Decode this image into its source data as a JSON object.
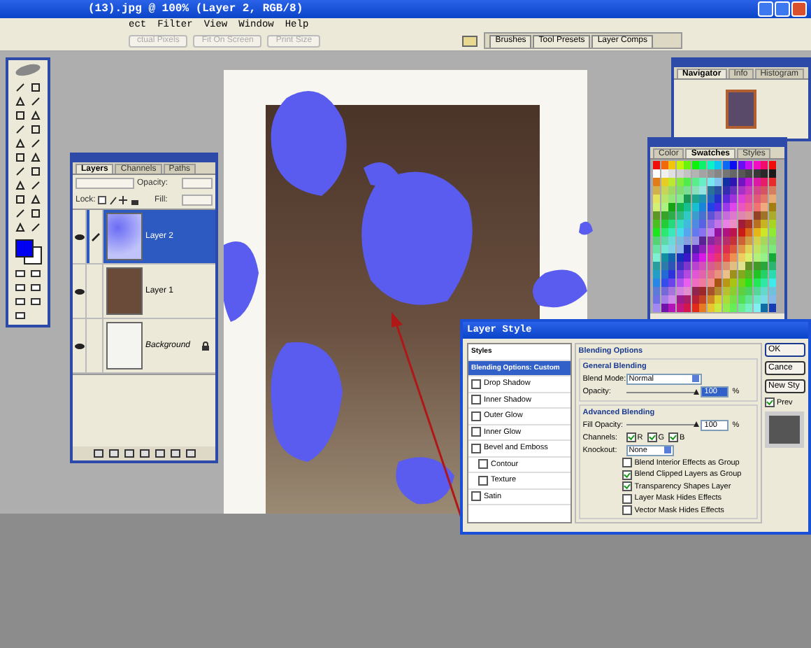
{
  "window": {
    "title": "(13).jpg @ 100% (Layer 2, RGB/8)"
  },
  "menu": [
    "ect",
    "Filter",
    "View",
    "Window",
    "Help"
  ],
  "options_bar": {
    "buttons": [
      {
        "label": "ctual Pixels",
        "disabled": true
      },
      {
        "label": "Fit On Screen",
        "disabled": true
      },
      {
        "label": "Print Size",
        "disabled": true
      }
    ]
  },
  "palette_well": {
    "tabs": [
      "Brushes",
      "Tool Presets",
      "Layer Comps"
    ]
  },
  "navigator": {
    "tabs": [
      {
        "label": "Navigator",
        "selected": true
      },
      {
        "label": "Info",
        "selected": false
      },
      {
        "label": "Histogram",
        "selected": false
      }
    ]
  },
  "swatches": {
    "tabs": [
      {
        "label": "Color",
        "selected": false
      },
      {
        "label": "Swatches",
        "selected": true
      },
      {
        "label": "Styles",
        "selected": false
      }
    ]
  },
  "layers": {
    "tabs": [
      {
        "label": "Layers",
        "selected": true
      },
      {
        "label": "Channels",
        "selected": false
      },
      {
        "label": "Paths",
        "selected": false
      }
    ],
    "opacity_label": "Opacity:",
    "lock_label": "Lock:",
    "fill_label": "Fill:",
    "items": [
      {
        "name": "Layer 2",
        "kind": "paint",
        "selected": true,
        "visible": true,
        "locked": false
      },
      {
        "name": "Layer 1",
        "kind": "photo",
        "selected": false,
        "visible": true,
        "locked": false
      },
      {
        "name": "Background",
        "kind": "blank",
        "selected": false,
        "visible": true,
        "locked": true
      }
    ]
  },
  "layer_style": {
    "title": "Layer Style",
    "styles": [
      {
        "label": "Styles",
        "kind": "heading",
        "selected": false
      },
      {
        "label": "Blending Options: Custom",
        "kind": "heading",
        "selected": true
      },
      {
        "label": "Drop Shadow",
        "kind": "effect",
        "selected": false,
        "checked": false
      },
      {
        "label": "Inner Shadow",
        "kind": "effect",
        "selected": false,
        "checked": false
      },
      {
        "label": "Outer Glow",
        "kind": "effect",
        "selected": false,
        "checked": false
      },
      {
        "label": "Inner Glow",
        "kind": "effect",
        "selected": false,
        "checked": false
      },
      {
        "label": "Bevel and Emboss",
        "kind": "effect",
        "selected": false,
        "checked": false
      },
      {
        "label": "Contour",
        "kind": "sub-effect",
        "selected": false,
        "checked": false
      },
      {
        "label": "Texture",
        "kind": "sub-effect",
        "selected": false,
        "checked": false
      },
      {
        "label": "Satin",
        "kind": "effect",
        "selected": false,
        "checked": false
      }
    ],
    "section_title": "Blending Options",
    "general_title": "General Blending",
    "blend_mode_label": "Blend Mode:",
    "blend_mode": "Normal",
    "opacity_label": "Opacity:",
    "opacity_slider": {
      "level": 1
    },
    "opacity": "100",
    "opacity_unit": "%",
    "advanced_title": "Advanced Blending",
    "fill_opacity_label": "Fill Opacity:",
    "fill_slider": {
      "level": 1
    },
    "fill_opacity": "100",
    "fill_unit": "%",
    "channels_label": "Channels:",
    "channels": [
      {
        "label": "R",
        "checked": true
      },
      {
        "label": "G",
        "checked": true
      },
      {
        "label": "B",
        "checked": true
      }
    ],
    "knockout_label": "Knockout:",
    "knockout": "None",
    "options": [
      {
        "label": "Blend Interior Effects as Group",
        "checked": false
      },
      {
        "label": "Blend Clipped Layers as Group",
        "checked": true
      },
      {
        "label": "Transparency Shapes Layer",
        "checked": true
      },
      {
        "label": "Layer Mask Hides Effects",
        "checked": false
      },
      {
        "label": "Vector Mask Hides Effects",
        "checked": false
      }
    ],
    "buttons": [
      "OK",
      "Cance",
      "New Sty"
    ],
    "preview": {
      "label": "Prev",
      "checked": true
    }
  }
}
